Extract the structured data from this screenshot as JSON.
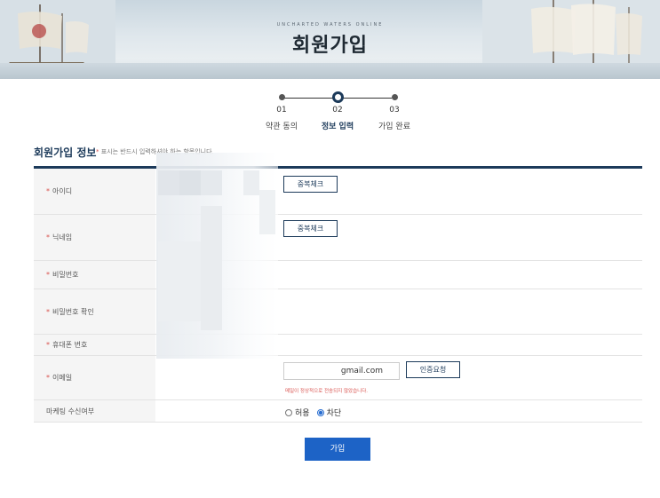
{
  "header": {
    "subtitle": "UNCHARTED WATERS ONLINE",
    "title": "회원가입"
  },
  "steps": [
    {
      "num": "01",
      "label": "약관 동의",
      "active": false
    },
    {
      "num": "02",
      "label": "정보 입력",
      "active": true
    },
    {
      "num": "03",
      "label": "가입 완료",
      "active": false
    }
  ],
  "section": {
    "title": "회원가입 정보",
    "note_star": "*",
    "note": "표시는 반드시 입력하셔야 하는 항목입니다."
  },
  "form": {
    "id_label": "아이디",
    "nickname_label": "닉네임",
    "password_label": "비밀번호",
    "password_confirm_label": "비밀번호 확인",
    "phone_label": "휴대폰 번호",
    "email_label": "이메일",
    "marketing_label": "마케팅 수신여부",
    "required_star": "*",
    "dup_check_label": "중복체크",
    "verify_label": "인증요청",
    "email_value": "gmail.com",
    "email_error": "메일이 정상적으로 전송되지 않았습니다.",
    "marketing_allow": "허용",
    "marketing_block": "차단",
    "marketing_selected": "차단"
  },
  "submit_label": "가입",
  "colors": {
    "navy": "#1c3a5a",
    "button_blue": "#1d63c6",
    "required_red": "#d9534f"
  }
}
